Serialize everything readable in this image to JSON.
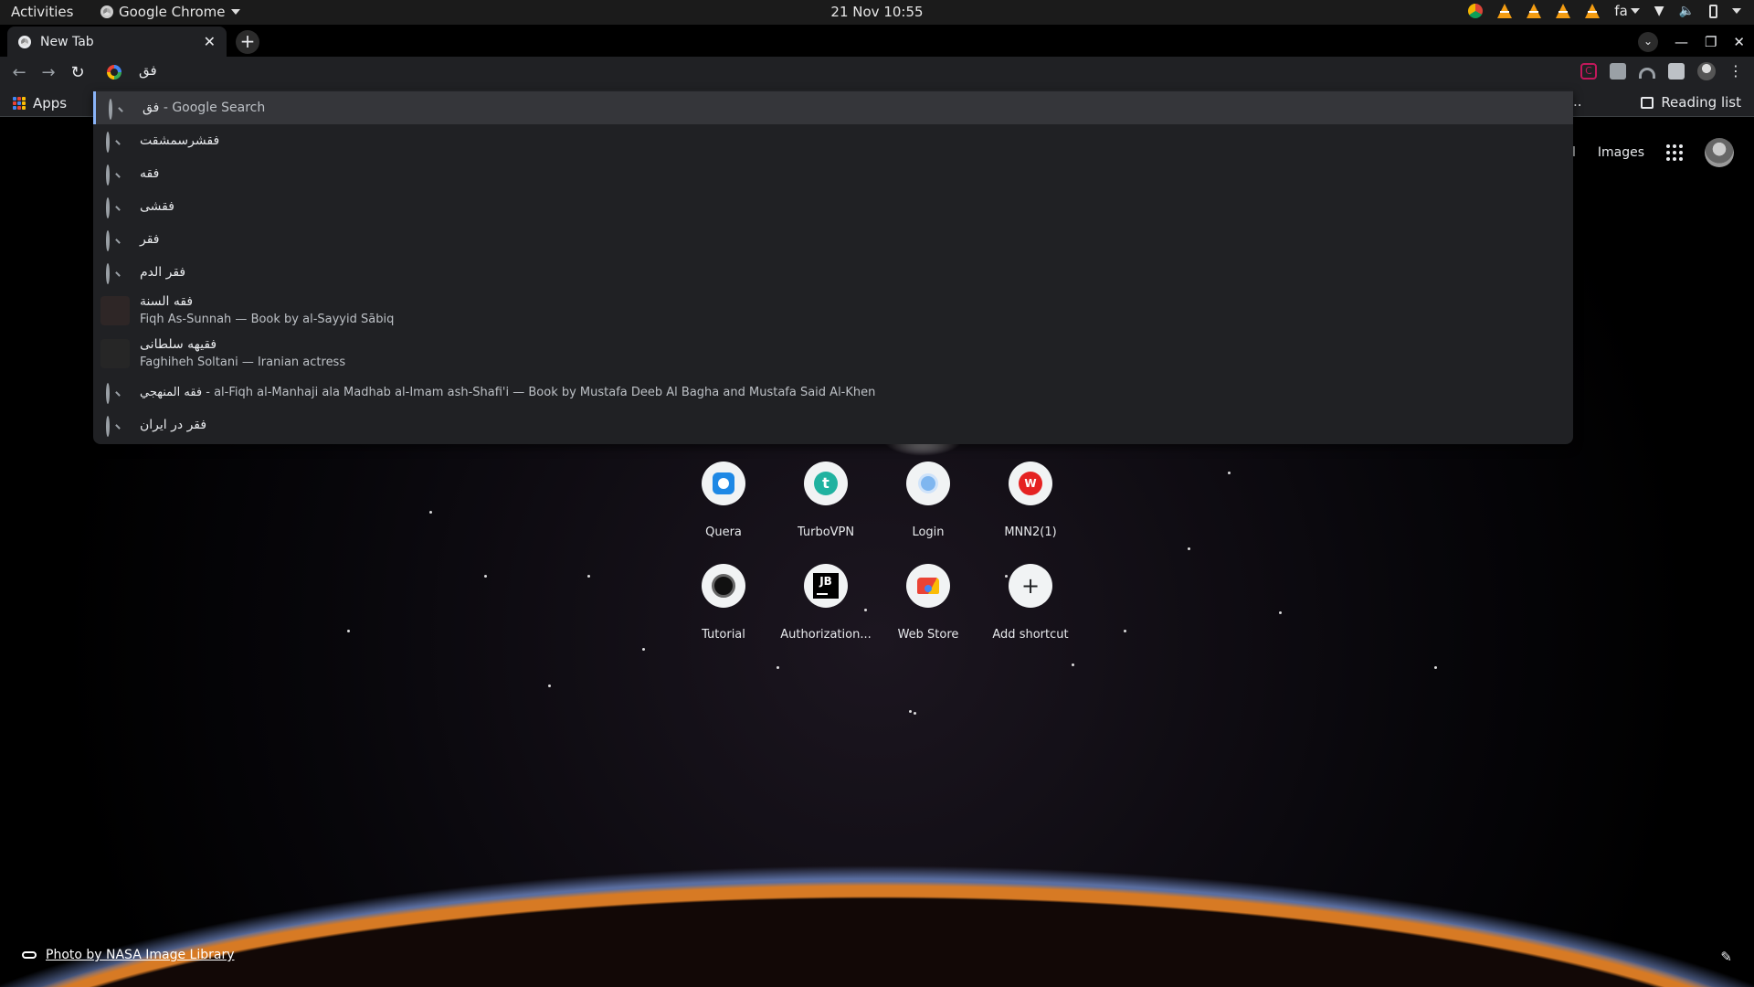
{
  "system_bar": {
    "activities": "Activities",
    "app_name": "Google Chrome",
    "clock": "21 Nov  10:55",
    "keyboard_layout": "fa"
  },
  "browser": {
    "tab_title": "New Tab",
    "omnibox_text": "فق",
    "bookmarks": {
      "apps_label": "Apps",
      "more": "..",
      "reading_list": "Reading list"
    }
  },
  "ntp": {
    "header": {
      "gmail": "mail",
      "images": "Images"
    },
    "shortcuts": [
      {
        "label": "Quera",
        "icon": "quera-icon"
      },
      {
        "label": "TurboVPN",
        "icon": "turbovpn-icon"
      },
      {
        "label": "Login",
        "icon": "login-icon"
      },
      {
        "label": "MNN2(1)",
        "icon": "mnn-icon",
        "glyph": "W"
      },
      {
        "label": "Tutorial",
        "icon": "tutorial-icon"
      },
      {
        "label": "Authorization...",
        "icon": "jetbrains-icon",
        "glyph": "JB"
      },
      {
        "label": "Web Store",
        "icon": "web-store-icon"
      },
      {
        "label": "Add shortcut",
        "icon": "plus-icon",
        "glyph": "+"
      }
    ],
    "photo_credit": "Photo by NASA Image Library"
  },
  "suggestions": [
    {
      "type": "search",
      "query": "فق",
      "suffix": " - Google Search"
    },
    {
      "type": "search",
      "query": "فقشرسمشقت"
    },
    {
      "type": "search",
      "query": "فقه"
    },
    {
      "type": "search",
      "query": "فقشی"
    },
    {
      "type": "search",
      "query": "فقر"
    },
    {
      "type": "search",
      "query": "فقر الدم"
    },
    {
      "type": "entity",
      "query": "فقه السنة",
      "description": "Fiqh As-Sunnah — Book by al-Sayyid Sābiq"
    },
    {
      "type": "entity",
      "query": "فقیهه سلطانی",
      "description": "Faghiheh Soltani — Iranian actress"
    },
    {
      "type": "search",
      "query": "فقه المنهجي",
      "suffix": " - al-Fiqh al-Manhaji ala Madhab al-Imam ash-Shafi'i — Book by Mustafa Deeb Al Bagha and Mustafa Said Al-Khen"
    },
    {
      "type": "search",
      "query": "فقر در ایران"
    }
  ],
  "colors": {
    "toolbar_bg": "#202124",
    "selection_accent": "#8ab4f8",
    "horizon_glow": "#d77a24"
  }
}
